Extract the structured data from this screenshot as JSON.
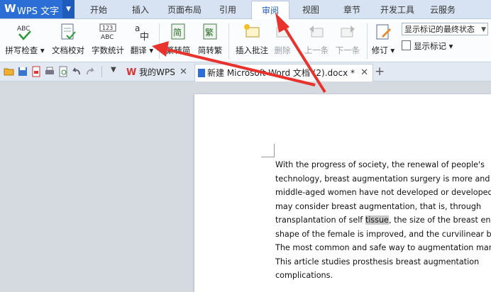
{
  "app": {
    "name": "WPS 文字",
    "logo_letter": "W"
  },
  "menu_tabs": [
    {
      "label": "开始"
    },
    {
      "label": "插入"
    },
    {
      "label": "页面布局"
    },
    {
      "label": "引用"
    },
    {
      "label": "审阅",
      "active": true
    },
    {
      "label": "视图"
    },
    {
      "label": "章节"
    },
    {
      "label": "开发工具"
    },
    {
      "label": "云服务"
    }
  ],
  "ribbon": {
    "spell_check": "拼写检查",
    "doc_proof": "文档校对",
    "word_count": "字数统计",
    "translate": "翻译",
    "trad_to_simp": "繁转简",
    "simp_to_trad": "简转繁",
    "insert_comment": "插入批注",
    "delete": "删除",
    "previous": "上一条",
    "next": "下一条",
    "track_changes": "修订",
    "show_marks": "显示标记",
    "markup_select_value": "显示标记的最终状态",
    "icon_text_abc": "ABC",
    "icon_text_123": "123",
    "icon_text_abc2": "ABC",
    "icon_text_a": "a",
    "icon_text_zh": "中",
    "icon_text_jian": "简",
    "icon_text_fan": "繁"
  },
  "doc_tabs": [
    {
      "label": "我的WPS"
    },
    {
      "label": "新建 Microsoft Word 文档 (2).docx *"
    }
  ],
  "document": {
    "lines": [
      "With the progress of society, the renewal of people's",
      "technology, breast augmentation surgery is more and",
      "middle-aged women have not developed or developed",
      "may consider breast augmentation, that is, through",
      [
        "transplantation of self ",
        "tissue",
        ", the size of the breast enla"
      ],
      "shape of the female is improved, and the curvilinear be",
      "The most common and safe way to augmentation mamm",
      "This article studies prosthesis breast augmentation",
      "complications."
    ]
  },
  "colors": {
    "accent": "#2b6fd6",
    "annotation_arrow": "#e8322b"
  }
}
